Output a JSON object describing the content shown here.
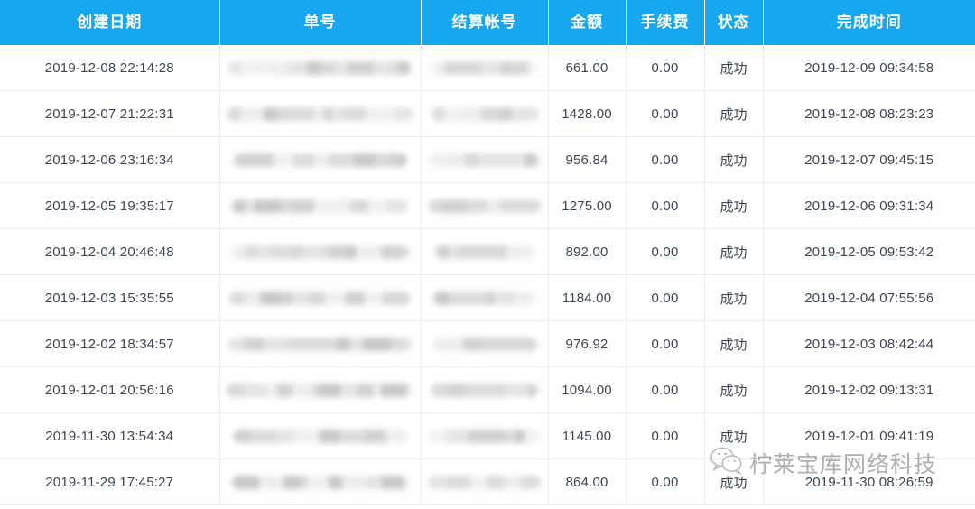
{
  "table": {
    "columns": [
      {
        "key": "create_date",
        "label": "创建日期"
      },
      {
        "key": "order_no",
        "label": "单号"
      },
      {
        "key": "settle_acct",
        "label": "结算帐号"
      },
      {
        "key": "amount",
        "label": "金额"
      },
      {
        "key": "fee",
        "label": "手续费"
      },
      {
        "key": "status",
        "label": "状态"
      },
      {
        "key": "finish_time",
        "label": "完成时间"
      }
    ],
    "header_bg": "#17a7ee",
    "header_color": "#ffffff",
    "row_border_color": "#ececec",
    "rows": [
      {
        "create_date": "2019-12-08 22:14:28",
        "order_no": "",
        "settle_acct": "",
        "amount": "661.00",
        "fee": "0.00",
        "status": "成功",
        "finish_time": "2019-12-09 09:34:58"
      },
      {
        "create_date": "2019-12-07 21:22:31",
        "order_no": "",
        "settle_acct": "",
        "amount": "1428.00",
        "fee": "0.00",
        "status": "成功",
        "finish_time": "2019-12-08 08:23:23"
      },
      {
        "create_date": "2019-12-06 23:16:34",
        "order_no": "",
        "settle_acct": "",
        "amount": "956.84",
        "fee": "0.00",
        "status": "成功",
        "finish_time": "2019-12-07 09:45:15"
      },
      {
        "create_date": "2019-12-05 19:35:17",
        "order_no": "",
        "settle_acct": "",
        "amount": "1275.00",
        "fee": "0.00",
        "status": "成功",
        "finish_time": "2019-12-06 09:31:34"
      },
      {
        "create_date": "2019-12-04 20:46:48",
        "order_no": "",
        "settle_acct": "",
        "amount": "892.00",
        "fee": "0.00",
        "status": "成功",
        "finish_time": "2019-12-05 09:53:42"
      },
      {
        "create_date": "2019-12-03 15:35:55",
        "order_no": "",
        "settle_acct": "",
        "amount": "1184.00",
        "fee": "0.00",
        "status": "成功",
        "finish_time": "2019-12-04 07:55:56"
      },
      {
        "create_date": "2019-12-02 18:34:57",
        "order_no": "",
        "settle_acct": "",
        "amount": "976.92",
        "fee": "0.00",
        "status": "成功",
        "finish_time": "2019-12-03 08:42:44"
      },
      {
        "create_date": "2019-12-01 20:56:16",
        "order_no": "",
        "settle_acct": "",
        "amount": "1094.00",
        "fee": "0.00",
        "status": "成功",
        "finish_time": "2019-12-02 09:13:31"
      },
      {
        "create_date": "2019-11-30 13:54:34",
        "order_no": "",
        "settle_acct": "",
        "amount": "1145.00",
        "fee": "0.00",
        "status": "成功",
        "finish_time": "2019-12-01 09:41:19"
      },
      {
        "create_date": "2019-11-29 17:45:27",
        "order_no": "",
        "settle_acct": "",
        "amount": "864.00",
        "fee": "0.00",
        "status": "成功",
        "finish_time": "2019-11-30 08:26:59"
      }
    ],
    "redacted_columns": [
      "order_no",
      "settle_acct"
    ]
  },
  "watermark": {
    "icon": "wechat-icon",
    "text": "柠莱宝库网络科技",
    "color": "#7f7f7f"
  }
}
